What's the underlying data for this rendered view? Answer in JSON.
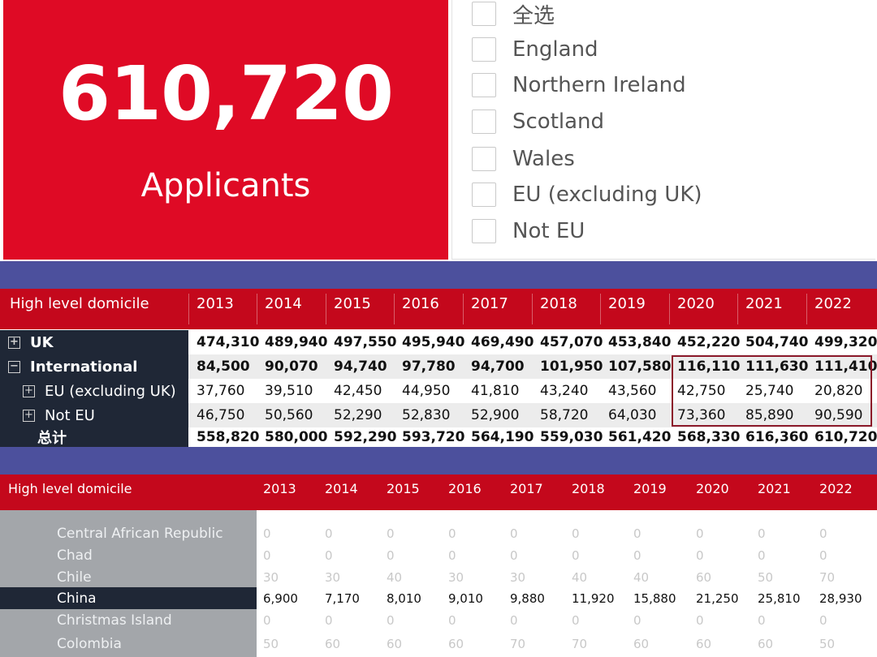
{
  "kpi": {
    "value": "610,720",
    "label": "Applicants"
  },
  "filters": [
    "全选",
    "England",
    "Northern Ireland",
    "Scotland",
    "Wales",
    "EU (excluding UK)",
    "Not EU"
  ],
  "years": [
    "2013",
    "2014",
    "2015",
    "2016",
    "2017",
    "2018",
    "2019",
    "2020",
    "2021",
    "2022"
  ],
  "table1": {
    "header_label": "High level domicile",
    "rows": [
      {
        "label": "UK",
        "expander": "+",
        "bold": true,
        "values": [
          "474,310",
          "489,940",
          "497,550",
          "495,940",
          "469,490",
          "457,070",
          "453,840",
          "452,220",
          "504,740",
          "499,320"
        ]
      },
      {
        "label": "International",
        "expander": "−",
        "bold": true,
        "values": [
          "84,500",
          "90,070",
          "94,740",
          "97,780",
          "94,700",
          "101,950",
          "107,580",
          "116,110",
          "111,630",
          "111,410"
        ]
      },
      {
        "label": "EU (excluding UK)",
        "expander": "+",
        "bold": false,
        "values": [
          "37,760",
          "39,510",
          "42,450",
          "44,950",
          "41,810",
          "43,240",
          "43,560",
          "42,750",
          "25,740",
          "20,820"
        ]
      },
      {
        "label": "Not EU",
        "expander": "+",
        "bold": false,
        "values": [
          "46,750",
          "50,560",
          "52,290",
          "52,830",
          "52,900",
          "58,720",
          "64,030",
          "73,360",
          "85,890",
          "90,590"
        ]
      },
      {
        "label": "总计",
        "expander": "",
        "bold": true,
        "values": [
          "558,820",
          "580,000",
          "592,290",
          "593,720",
          "564,190",
          "559,030",
          "561,420",
          "568,330",
          "616,360",
          "610,720"
        ]
      }
    ]
  },
  "table2": {
    "header_label": "High level domicile",
    "rows": [
      {
        "label": "Central African Republic",
        "selected": false,
        "values": [
          "0",
          "0",
          "0",
          "0",
          "0",
          "0",
          "0",
          "0",
          "0",
          "0"
        ]
      },
      {
        "label": "Chad",
        "selected": false,
        "values": [
          "0",
          "0",
          "0",
          "0",
          "0",
          "0",
          "0",
          "0",
          "0",
          "0"
        ]
      },
      {
        "label": "Chile",
        "selected": false,
        "values": [
          "30",
          "30",
          "40",
          "30",
          "30",
          "40",
          "40",
          "60",
          "50",
          "70"
        ]
      },
      {
        "label": "China",
        "selected": true,
        "values": [
          "6,900",
          "7,170",
          "8,010",
          "9,010",
          "9,880",
          "11,920",
          "15,880",
          "21,250",
          "25,810",
          "28,930"
        ]
      },
      {
        "label": "Christmas Island",
        "selected": false,
        "values": [
          "0",
          "0",
          "0",
          "0",
          "0",
          "0",
          "0",
          "0",
          "0",
          "0"
        ]
      },
      {
        "label": "Colombia",
        "selected": false,
        "values": [
          "50",
          "60",
          "60",
          "60",
          "70",
          "70",
          "60",
          "60",
          "60",
          "50"
        ]
      }
    ]
  }
}
